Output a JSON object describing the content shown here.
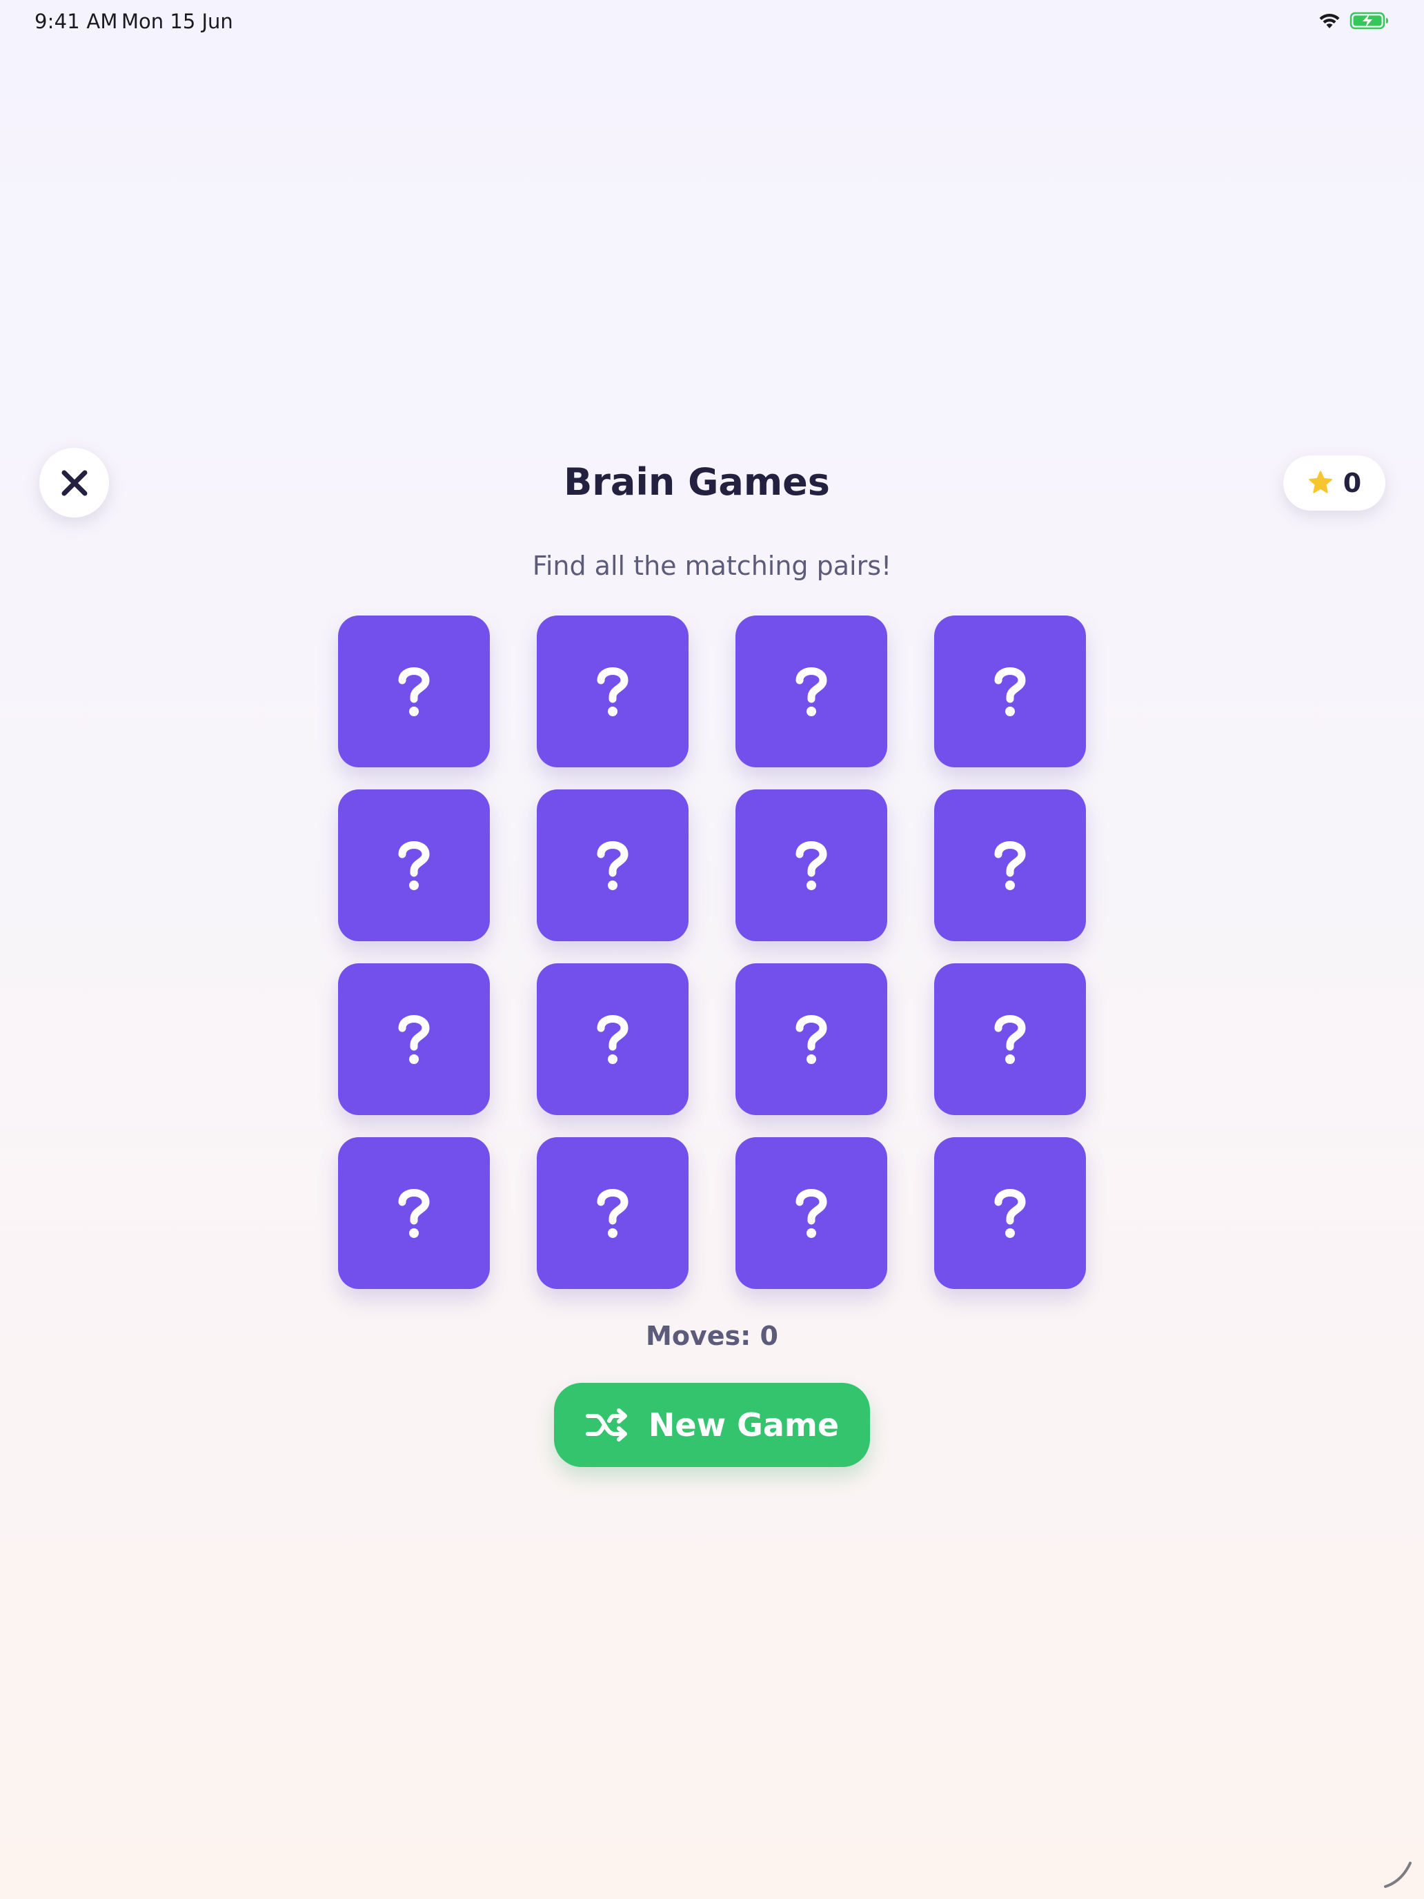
{
  "status_bar": {
    "time": "9:41 AM",
    "date": "Mon 15 Jun",
    "icons": [
      "wifi-icon",
      "battery-charging-icon"
    ]
  },
  "header": {
    "title": "Brain Games",
    "close_icon": "close-icon",
    "score": {
      "icon": "star-icon",
      "value": "0"
    }
  },
  "game": {
    "subtitle": "Find all the matching pairs!",
    "grid": {
      "rows": 4,
      "columns": 4,
      "card_state": "face-down",
      "card_icon": "question-mark-icon"
    },
    "moves_text": "Moves: 0",
    "moves": 0,
    "new_game": {
      "label": "New Game",
      "icon": "shuffle-icon"
    }
  },
  "colors": {
    "card": "#7350eb",
    "button": "#34c46e",
    "star": "#f7c52e",
    "title": "#23213f",
    "subtitle": "#5d5b7a",
    "battery": "#34c759"
  }
}
